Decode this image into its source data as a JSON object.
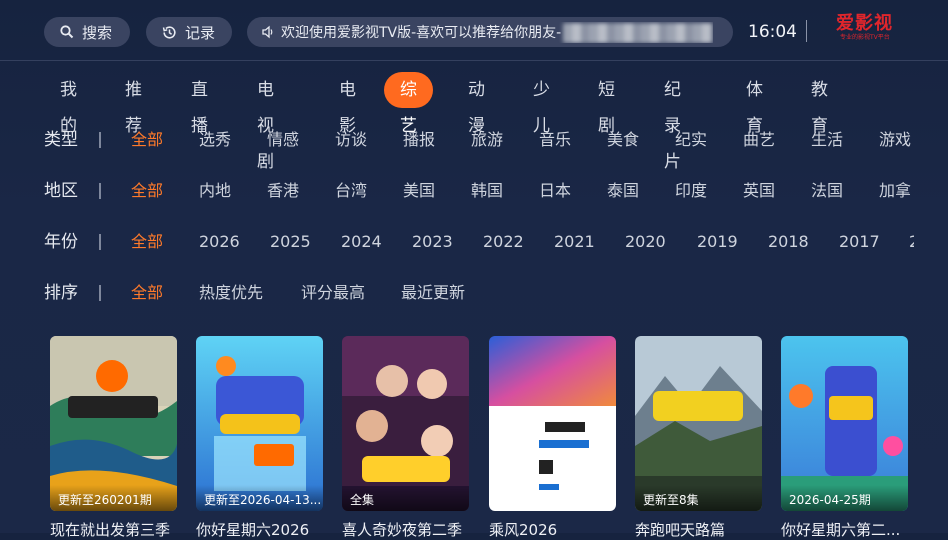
{
  "header": {
    "search_label": "搜索",
    "record_label": "记录",
    "marquee_text": "欢迎使用爱影视TV版-喜欢可以推荐给你朋友-",
    "clock": "16:04",
    "logo_text": "爱影视",
    "logo_sub": "专业的影视TV平台"
  },
  "categories": [
    {
      "label": "我的",
      "active": false
    },
    {
      "label": "推荐",
      "active": false
    },
    {
      "label": "直播",
      "active": false
    },
    {
      "label": "电视剧",
      "active": false
    },
    {
      "label": "电影",
      "active": false
    },
    {
      "label": "综艺",
      "active": true
    },
    {
      "label": "动漫",
      "active": false
    },
    {
      "label": "少儿",
      "active": false
    },
    {
      "label": "短剧",
      "active": false
    },
    {
      "label": "纪录片",
      "active": false
    },
    {
      "label": "体育",
      "active": false
    },
    {
      "label": "教育",
      "active": false
    }
  ],
  "filters": {
    "type": {
      "label": "类型",
      "options": [
        "全部",
        "选秀",
        "情感",
        "访谈",
        "播报",
        "旅游",
        "音乐",
        "美食",
        "纪实",
        "曲艺",
        "生活",
        "游戏"
      ]
    },
    "region": {
      "label": "地区",
      "options": [
        "全部",
        "内地",
        "香港",
        "台湾",
        "美国",
        "韩国",
        "日本",
        "泰国",
        "印度",
        "英国",
        "法国",
        "加拿"
      ]
    },
    "year": {
      "label": "年份",
      "options": [
        "全部",
        "2026",
        "2025",
        "2024",
        "2023",
        "2022",
        "2021",
        "2020",
        "2019",
        "2018",
        "2017",
        "2"
      ]
    },
    "sort": {
      "label": "排序",
      "options": [
        "全部",
        "热度优先",
        "评分最高",
        "最近更新"
      ]
    }
  },
  "accent_color": "#ff6a1f",
  "posters": [
    {
      "badge": "更新至260201期",
      "title": "现在就出发第三季"
    },
    {
      "badge": "更新至2026-04-13...",
      "title": "你好星期六2026"
    },
    {
      "badge": "全集",
      "title": "喜人奇妙夜第二季"
    },
    {
      "badge": "",
      "title": "乘风2026"
    },
    {
      "badge": "更新至8集",
      "title": "奔跑吧天路篇"
    },
    {
      "badge": "2026-04-25期",
      "title": "你好星期六第二..."
    }
  ]
}
